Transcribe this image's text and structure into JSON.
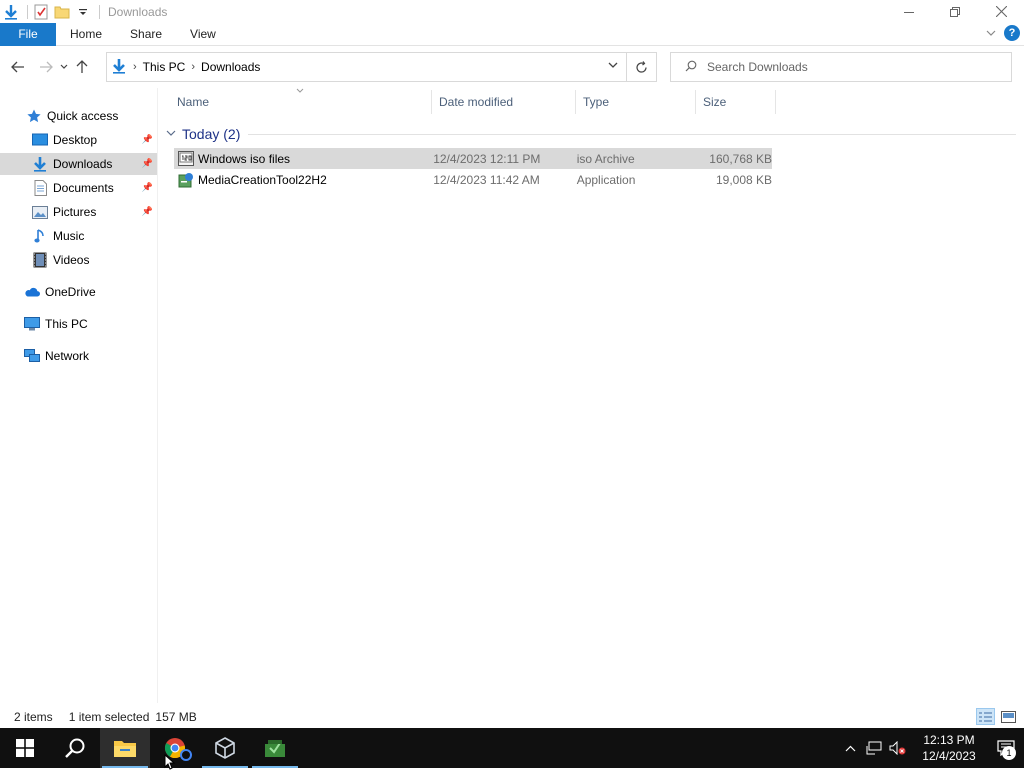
{
  "window": {
    "title": "Downloads",
    "controls": {
      "minimize": "—",
      "restore": "❐",
      "close": "✕"
    }
  },
  "ribbon": {
    "tabs": [
      {
        "label": "File"
      },
      {
        "label": "Home"
      },
      {
        "label": "Share"
      },
      {
        "label": "View"
      }
    ],
    "help_label": "?"
  },
  "address": {
    "crumbs": [
      "This PC",
      "Downloads"
    ],
    "search_placeholder": "Search Downloads"
  },
  "navpane": {
    "items": [
      {
        "label": "Quick access",
        "icon": "star-icon"
      },
      {
        "label": "Desktop",
        "icon": "desktop-icon",
        "pinned": true
      },
      {
        "label": "Downloads",
        "icon": "download-icon",
        "pinned": true,
        "selected": true
      },
      {
        "label": "Documents",
        "icon": "documents-icon",
        "pinned": true
      },
      {
        "label": "Pictures",
        "icon": "pictures-icon",
        "pinned": true
      },
      {
        "label": "Music",
        "icon": "music-icon"
      },
      {
        "label": "Videos",
        "icon": "videos-icon"
      },
      {
        "label": "OneDrive",
        "icon": "cloud-icon"
      },
      {
        "label": "This PC",
        "icon": "computer-icon"
      },
      {
        "label": "Network",
        "icon": "network-icon"
      }
    ]
  },
  "columns": [
    "Name",
    "Date modified",
    "Type",
    "Size"
  ],
  "group": {
    "label": "Today (2)"
  },
  "files": [
    {
      "name": "Windows iso files",
      "date": "12/4/2023 12:11 PM",
      "type": "iso Archive",
      "size": "160,768 KB",
      "selected": true,
      "icon": "iso-archive-icon"
    },
    {
      "name": "MediaCreationTool22H2",
      "date": "12/4/2023 11:42 AM",
      "type": "Application",
      "size": "19,008 KB",
      "selected": false,
      "icon": "setup-app-icon"
    }
  ],
  "status": {
    "count": "2 items",
    "selection": "1 item selected",
    "size": "157 MB"
  },
  "taskbar": {
    "apps": [
      "start-icon",
      "search-icon",
      "file-explorer-icon",
      "chrome-icon",
      "virtualbox-icon",
      "app-icon"
    ],
    "time": "12:13 PM",
    "date": "12/4/2023",
    "notification_count": "1"
  }
}
